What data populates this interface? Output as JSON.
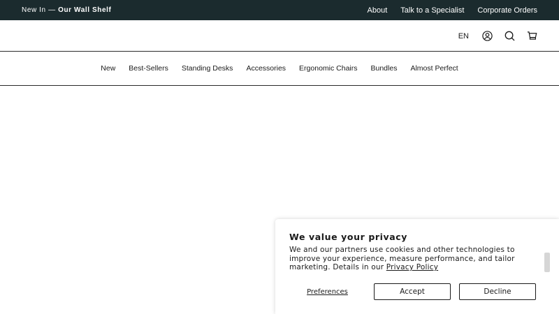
{
  "announcement": {
    "prefix": "New In — ",
    "highlight": "Our Wall Shelf",
    "links": [
      "About",
      "Talk to a Specialist",
      "Corporate Orders"
    ]
  },
  "header": {
    "language": "EN",
    "icons": [
      "account-icon",
      "search-icon",
      "cart-icon"
    ]
  },
  "nav": {
    "items": [
      "New",
      "Best-Sellers",
      "Standing Desks",
      "Accessories",
      "Ergonomic Chairs",
      "Bundles",
      "Almost Perfect"
    ]
  },
  "cookie_banner": {
    "title": "We value your privacy",
    "body": "We and our partners use cookies and other technologies to improve your experience, measure performance, and tailor marketing. Details in our ",
    "link": "Privacy Policy",
    "preferences": "Preferences",
    "accept": "Accept",
    "decline": "Decline"
  },
  "colors": {
    "announcement_bg": "#1b2b2e",
    "text": "#1a1a1a"
  }
}
